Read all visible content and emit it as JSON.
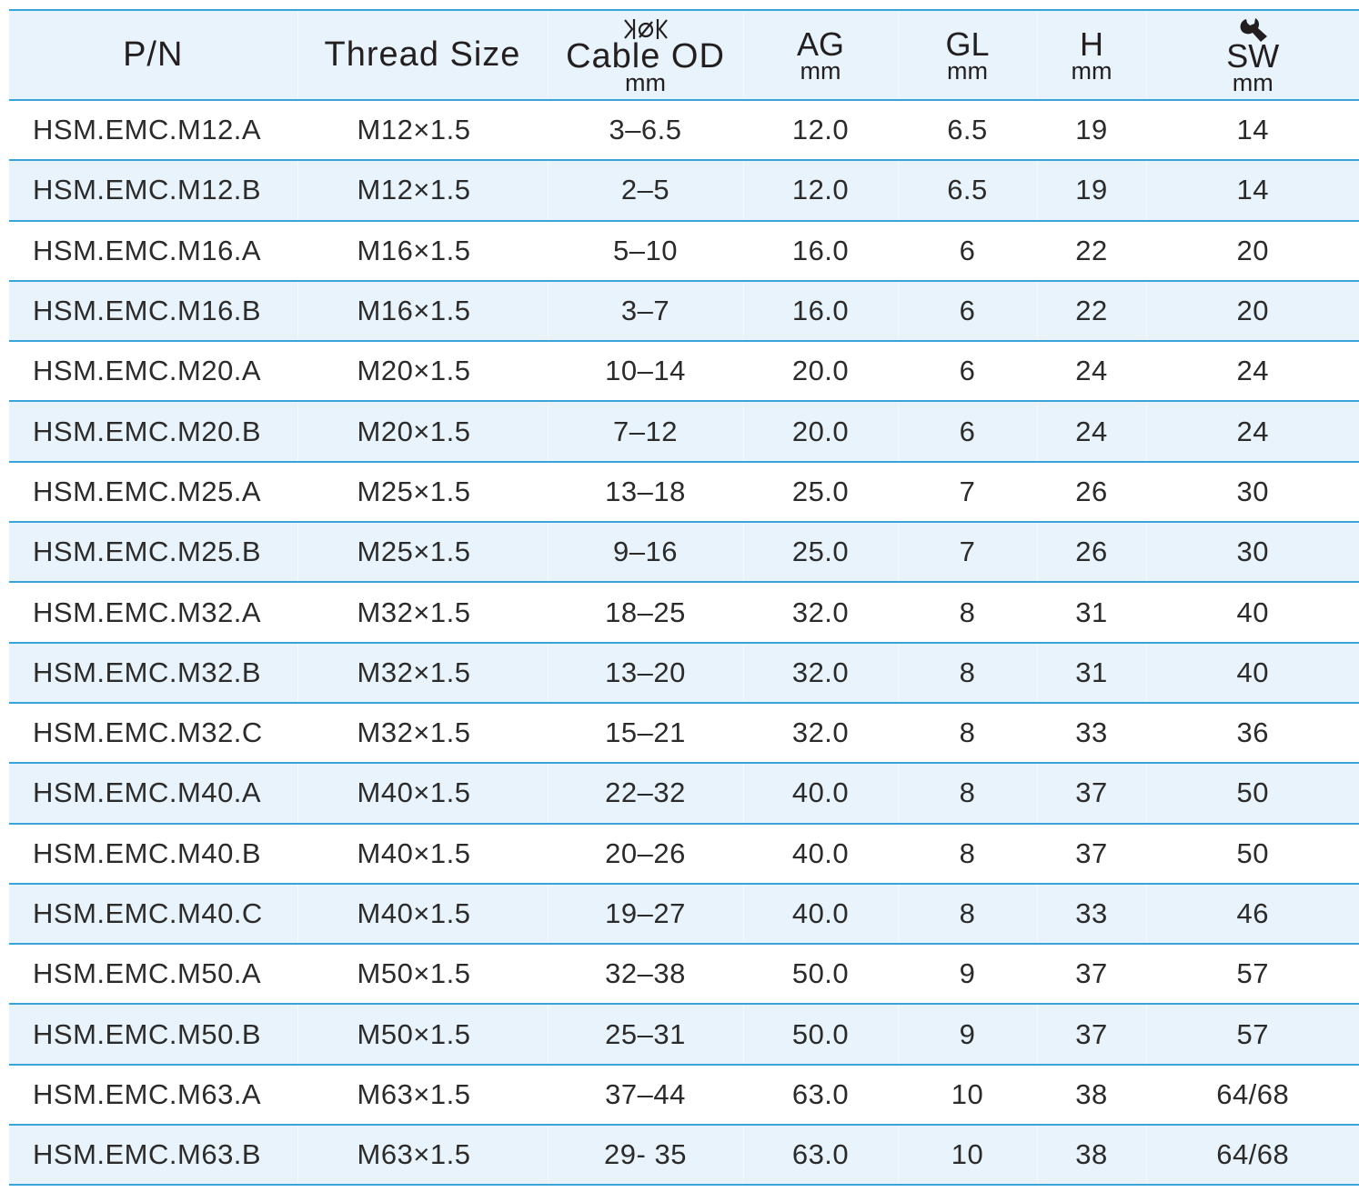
{
  "table": {
    "headers": [
      {
        "label": "P/N"
      },
      {
        "label": "Thread Size"
      },
      {
        "label": "Cable OD",
        "unit": "mm",
        "icon": "cable-diameter-icon",
        "icon_glyph": "ɟøƙ"
      },
      {
        "label": "AG",
        "unit": "mm"
      },
      {
        "label": "GL",
        "unit": "mm"
      },
      {
        "label": "H",
        "unit": "mm"
      },
      {
        "label": "SW",
        "unit": "mm",
        "icon": "wrench-icon"
      }
    ],
    "rows": [
      [
        "HSM.EMC.M12.A",
        "M12×1.5",
        "3–6.5",
        "12.0",
        "6.5",
        "19",
        "14"
      ],
      [
        "HSM.EMC.M12.B",
        "M12×1.5",
        "2–5",
        "12.0",
        "6.5",
        "19",
        "14"
      ],
      [
        "HSM.EMC.M16.A",
        "M16×1.5",
        "5–10",
        "16.0",
        "6",
        "22",
        "20"
      ],
      [
        "HSM.EMC.M16.B",
        "M16×1.5",
        "3–7",
        "16.0",
        "6",
        "22",
        "20"
      ],
      [
        "HSM.EMC.M20.A",
        "M20×1.5",
        "10–14",
        "20.0",
        "6",
        "24",
        "24"
      ],
      [
        "HSM.EMC.M20.B",
        "M20×1.5",
        "7–12",
        "20.0",
        "6",
        "24",
        "24"
      ],
      [
        "HSM.EMC.M25.A",
        "M25×1.5",
        "13–18",
        "25.0",
        "7",
        "26",
        "30"
      ],
      [
        "HSM.EMC.M25.B",
        "M25×1.5",
        "9–16",
        "25.0",
        "7",
        "26",
        "30"
      ],
      [
        "HSM.EMC.M32.A",
        "M32×1.5",
        "18–25",
        "32.0",
        "8",
        "31",
        "40"
      ],
      [
        "HSM.EMC.M32.B",
        "M32×1.5",
        "13–20",
        "32.0",
        "8",
        "31",
        "40"
      ],
      [
        "HSM.EMC.M32.C",
        "M32×1.5",
        "15–21",
        "32.0",
        "8",
        "33",
        "36"
      ],
      [
        "HSM.EMC.M40.A",
        "M40×1.5",
        "22–32",
        "40.0",
        "8",
        "37",
        "50"
      ],
      [
        "HSM.EMC.M40.B",
        "M40×1.5",
        "20–26",
        "40.0",
        "8",
        "37",
        "50"
      ],
      [
        "HSM.EMC.M40.C",
        "M40×1.5",
        "19–27",
        "40.0",
        "8",
        "33",
        "46"
      ],
      [
        "HSM.EMC.M50.A",
        "M50×1.5",
        "32–38",
        "50.0",
        "9",
        "37",
        "57"
      ],
      [
        "HSM.EMC.M50.B",
        "M50×1.5",
        "25–31",
        "50.0",
        "9",
        "37",
        "57"
      ],
      [
        "HSM.EMC.M63.A",
        "M63×1.5",
        "37–44",
        "63.0",
        "10",
        "38",
        "64/68"
      ],
      [
        "HSM.EMC.M63.B",
        "M63×1.5",
        "29- 35",
        "63.0",
        "10",
        "38",
        "64/68"
      ]
    ]
  },
  "colors": {
    "rule": "#3aa3d8",
    "band": "#e8f3fb",
    "text": "#231f20"
  }
}
